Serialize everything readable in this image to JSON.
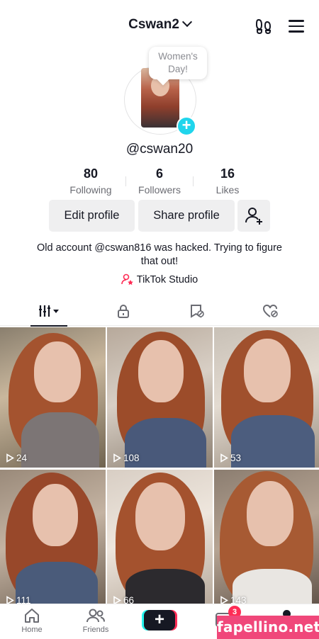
{
  "header": {
    "username": "Cswan2",
    "bubble_text_line1": "Women's",
    "bubble_text_line2": "Day!"
  },
  "profile": {
    "handle": "@cswan20",
    "stats": [
      {
        "value": "80",
        "label": "Following"
      },
      {
        "value": "6",
        "label": "Followers"
      },
      {
        "value": "16",
        "label": "Likes"
      }
    ],
    "edit_button": "Edit profile",
    "share_button": "Share profile",
    "bio_line1": "Old account @cswan816 was hacked. Trying to figure",
    "bio_line2": "that out!",
    "studio_link": "TikTok Studio"
  },
  "tabs": [
    {
      "icon": "videos-grid-icon",
      "active": true
    },
    {
      "icon": "lock-icon",
      "active": false
    },
    {
      "icon": "bookmark-icon",
      "active": false
    },
    {
      "icon": "heart-hidden-icon",
      "active": false
    }
  ],
  "videos": [
    {
      "views": "24"
    },
    {
      "views": "108"
    },
    {
      "views": "53"
    },
    {
      "views": "111"
    },
    {
      "views": "66"
    },
    {
      "views": "143"
    }
  ],
  "bottom_nav": {
    "home": "Home",
    "friends": "Friends",
    "inbox_badge": "3"
  },
  "watermark": "fapellino.net",
  "colors": {
    "accent_cyan": "#20d5ec",
    "accent_red": "#fe2c55",
    "button_bg": "#efeff0"
  }
}
